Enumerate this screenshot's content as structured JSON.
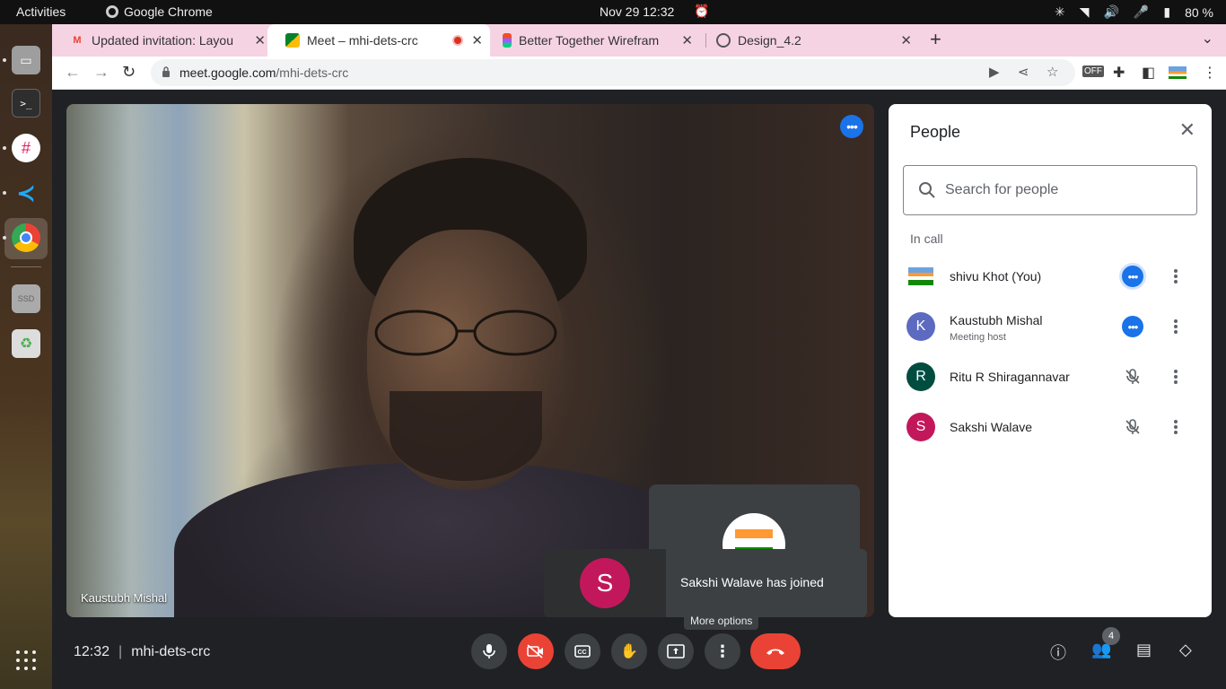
{
  "system": {
    "activities": "Activities",
    "app_name": "Google Chrome",
    "clock": "Nov 29  12:32",
    "battery": "80 %"
  },
  "browser": {
    "tabs": [
      {
        "title": "Updated invitation: Layou",
        "icon": "gmail-icon"
      },
      {
        "title": "Meet – mhi-dets-crc",
        "icon": "meet-icon",
        "active": true
      },
      {
        "title": "Better Together Wirefram",
        "icon": "figma-icon"
      },
      {
        "title": "Design_4.2",
        "icon": "globe-icon"
      }
    ],
    "url_host": "meet.google.com",
    "url_path": "/mhi-dets-crc"
  },
  "meeting": {
    "main_speaker": "Kaustubh Mishal",
    "time": "12:32",
    "code": "mhi-dets-crc",
    "toast": "Sakshi Walave has joined",
    "toast_avatar": "S",
    "tooltip": "More options",
    "participant_count": "4"
  },
  "people_panel": {
    "title": "People",
    "search_placeholder": "Search for people",
    "section": "In call",
    "participants": [
      {
        "name": "shivu Khot (You)",
        "subtitle": "",
        "avatar": "",
        "avatar_color": "",
        "status": "speaking"
      },
      {
        "name": "Kaustubh Mishal",
        "subtitle": "Meeting host",
        "avatar": "K",
        "avatar_color": "#5c6bc0",
        "status": "speaking"
      },
      {
        "name": "Ritu R Shiragannavar",
        "subtitle": "",
        "avatar": "R",
        "avatar_color": "#004d40",
        "status": "muted"
      },
      {
        "name": "Sakshi Walave",
        "subtitle": "",
        "avatar": "S",
        "avatar_color": "#c2185b",
        "status": "muted"
      }
    ]
  },
  "colors": {
    "meet_bg": "#202124",
    "accent_blue": "#1a73e8",
    "end_call_red": "#ea4335",
    "tabstrip": "#f6d3e3"
  }
}
